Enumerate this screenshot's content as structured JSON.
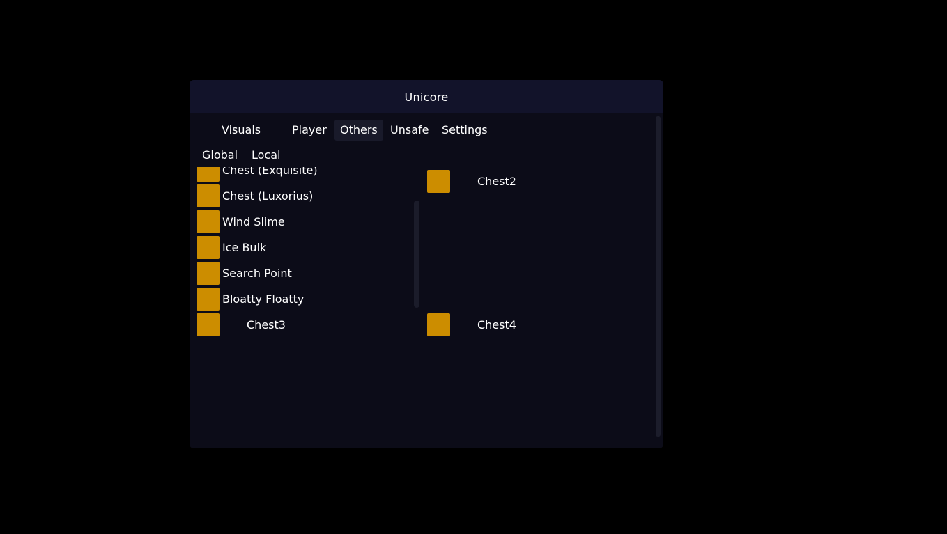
{
  "window": {
    "title": "Unicore"
  },
  "tabs": [
    {
      "label": "Visuals",
      "active": false
    },
    {
      "label": "Player",
      "active": false
    },
    {
      "label": "Others",
      "active": true
    },
    {
      "label": "Unsafe",
      "active": false
    },
    {
      "label": "Settings",
      "active": false
    }
  ],
  "subtabs": [
    {
      "label": "Global"
    },
    {
      "label": "Local"
    }
  ],
  "left_list": {
    "items": [
      {
        "label": "Chest (Exquisite)"
      },
      {
        "label": "Chest (Luxorius)"
      },
      {
        "label": "Wind Slime"
      },
      {
        "label": "Ice Bulk"
      },
      {
        "label": "Search Point"
      },
      {
        "label": "Bloatty Floatty"
      }
    ]
  },
  "color_items": {
    "chest2": "Chest2",
    "chest3": "Chest3",
    "chest4": "Chest4"
  },
  "colors": {
    "swatch": "#cc8d00",
    "window_bg": "#0c0c18",
    "titlebar_bg": "#12132a",
    "active_tab_bg": "#191a2a"
  }
}
